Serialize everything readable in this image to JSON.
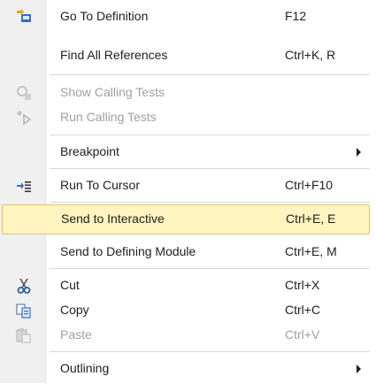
{
  "menu": {
    "items": [
      {
        "label": "Go To Definition",
        "shortcut": "F12",
        "icon": "go-to-definition-icon"
      },
      {
        "label": "Find All References",
        "shortcut": "Ctrl+K, R",
        "icon": ""
      },
      {
        "label": "Show Calling Tests",
        "shortcut": "",
        "icon": "show-calling-tests-icon",
        "disabled": true
      },
      {
        "label": "Run Calling Tests",
        "shortcut": "",
        "icon": "run-calling-tests-icon",
        "disabled": true
      },
      {
        "label": "Breakpoint",
        "shortcut": "",
        "icon": "",
        "submenu": true
      },
      {
        "label": "Run To Cursor",
        "shortcut": "Ctrl+F10",
        "icon": "run-to-cursor-icon"
      },
      {
        "label": "Send to Interactive",
        "shortcut": "Ctrl+E, E",
        "icon": "",
        "highlighted": true
      },
      {
        "label": "Send to Defining Module",
        "shortcut": "Ctrl+E, M",
        "icon": ""
      },
      {
        "label": "Cut",
        "shortcut": "Ctrl+X",
        "icon": "scissors-icon"
      },
      {
        "label": "Copy",
        "shortcut": "Ctrl+C",
        "icon": "copy-icon"
      },
      {
        "label": "Paste",
        "shortcut": "Ctrl+V",
        "icon": "paste-icon",
        "disabled": true
      },
      {
        "label": "Outlining",
        "shortcut": "",
        "icon": "",
        "submenu": true
      }
    ]
  },
  "colors": {
    "highlight_bg": "#fdf4bf",
    "highlight_border": "#e5c365",
    "disabled_text": "#a0a0a0"
  }
}
